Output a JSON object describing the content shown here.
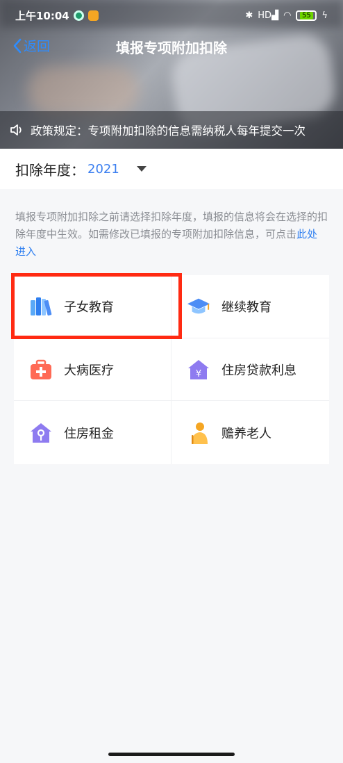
{
  "status": {
    "time": "上午10:04",
    "signal": "HD",
    "battery": "55"
  },
  "nav": {
    "back_label": "返回",
    "title": "填报专项附加扣除"
  },
  "notice": {
    "text": "政策规定：专项附加扣除的信息需纳税人每年提交一次"
  },
  "year": {
    "label": "扣除年度：",
    "value": "2021"
  },
  "hint": {
    "text": "填报专项附加扣除之前请选择扣除年度，填报的信息将会在选择的扣除年度中生效。如需修改已填报的专项附加扣除信息，可点击",
    "link": "此处进入"
  },
  "items": [
    {
      "label": "子女教育",
      "icon": "books-icon",
      "highlighted": true
    },
    {
      "label": "继续教育",
      "icon": "graduation-cap-icon"
    },
    {
      "label": "大病医疗",
      "icon": "medical-kit-icon"
    },
    {
      "label": "住房贷款利息",
      "icon": "house-yen-icon"
    },
    {
      "label": "住房租金",
      "icon": "house-key-icon"
    },
    {
      "label": "赡养老人",
      "icon": "elderly-icon"
    }
  ],
  "colors": {
    "accent": "#2f7ff0",
    "highlight": "#ff2a12",
    "hint": "#8a8d93"
  }
}
